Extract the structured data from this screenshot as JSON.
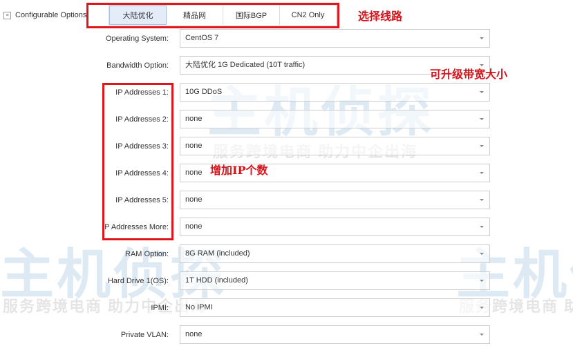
{
  "watermark": {
    "logo": "主机侦探",
    "slogan": "服务跨境电商 助力中企出海"
  },
  "section": {
    "title": "Configurable Options"
  },
  "tabs": [
    {
      "label": "大陆优化",
      "active": true
    },
    {
      "label": "精品网"
    },
    {
      "label": "国际BGP"
    },
    {
      "label": "CN2 Only"
    }
  ],
  "annotations": {
    "route": "选择线路",
    "bandwidth": "可升级带宽大小",
    "ip": "增加IP个数"
  },
  "options": [
    {
      "label": "Operating System:",
      "value": "CentOS 7"
    },
    {
      "label": "Bandwidth Option:",
      "value": "大陆优化 1G Dedicated (10T traffic)"
    },
    {
      "label": "IP Addresses 1:",
      "value": "10G DDoS"
    },
    {
      "label": "IP Addresses 2:",
      "value": "none"
    },
    {
      "label": "IP Addresses 3:",
      "value": "none"
    },
    {
      "label": "IP Addresses 4:",
      "value": "none"
    },
    {
      "label": "IP Addresses 5:",
      "value": "none"
    },
    {
      "label": "IP Addresses More:",
      "value": "none"
    },
    {
      "label": "RAM Option:",
      "value": "8G RAM (included)"
    },
    {
      "label": "Hard Drive 1(OS):",
      "value": "1T HDD (included)"
    },
    {
      "label": "IPMI:",
      "value": "No IPMI"
    },
    {
      "label": "Private VLAN:",
      "value": "none"
    }
  ]
}
